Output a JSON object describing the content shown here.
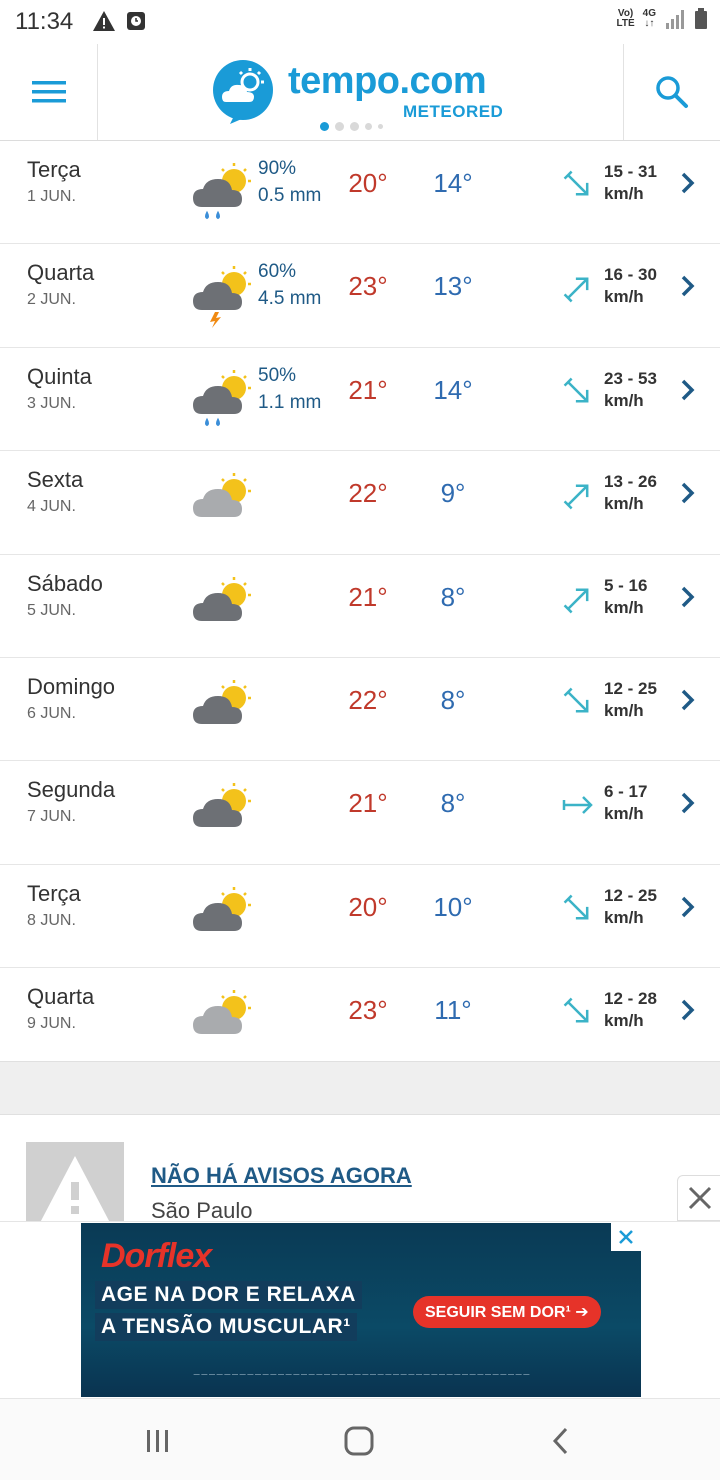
{
  "status_bar": {
    "time": "11:34",
    "volte_top": "Vo)",
    "volte_bottom": "LTE",
    "network_top": "4G",
    "network_bottom": "↓↑"
  },
  "header": {
    "brand": "tempo.com",
    "brand_sub": "METEORED",
    "menu_icon": "hamburger-menu-icon",
    "search_icon": "search-icon",
    "accent_color": "#1a9bd7"
  },
  "forecast": [
    {
      "day": "Terça",
      "date": "1 JUN.",
      "icon": "cloud-rain-sun",
      "precip_prob": "90%",
      "precip_amount": "0.5 mm",
      "tmax": "20°",
      "tmin": "14°",
      "wind_dir": 135,
      "wind_speed": "15 - 31",
      "wind_unit": "km/h"
    },
    {
      "day": "Quarta",
      "date": "2 JUN.",
      "icon": "cloud-storm-sun",
      "precip_prob": "60%",
      "precip_amount": "4.5 mm",
      "tmax": "23°",
      "tmin": "13°",
      "wind_dir": 45,
      "wind_speed": "16 - 30",
      "wind_unit": "km/h"
    },
    {
      "day": "Quinta",
      "date": "3 JUN.",
      "icon": "cloud-rain-sun",
      "precip_prob": "50%",
      "precip_amount": "1.1 mm",
      "tmax": "21°",
      "tmin": "14°",
      "wind_dir": 135,
      "wind_speed": "23 - 53",
      "wind_unit": "km/h"
    },
    {
      "day": "Sexta",
      "date": "4 JUN.",
      "icon": "cloud-sun-light",
      "precip_prob": "",
      "precip_amount": "",
      "tmax": "22°",
      "tmin": "9°",
      "wind_dir": 45,
      "wind_speed": "13 - 26",
      "wind_unit": "km/h"
    },
    {
      "day": "Sábado",
      "date": "5 JUN.",
      "icon": "cloud-sun-dark",
      "precip_prob": "",
      "precip_amount": "",
      "tmax": "21°",
      "tmin": "8°",
      "wind_dir": 45,
      "wind_speed": "5 - 16",
      "wind_unit": "km/h"
    },
    {
      "day": "Domingo",
      "date": "6 JUN.",
      "icon": "cloud-sun-dark",
      "precip_prob": "",
      "precip_amount": "",
      "tmax": "22°",
      "tmin": "8°",
      "wind_dir": 135,
      "wind_speed": "12 - 25",
      "wind_unit": "km/h"
    },
    {
      "day": "Segunda",
      "date": "7 JUN.",
      "icon": "cloud-sun-dark",
      "precip_prob": "",
      "precip_amount": "",
      "tmax": "21°",
      "tmin": "8°",
      "wind_dir": 90,
      "wind_speed": "6 - 17",
      "wind_unit": "km/h"
    },
    {
      "day": "Terça",
      "date": "8 JUN.",
      "icon": "cloud-sun-dark",
      "precip_prob": "",
      "precip_amount": "",
      "tmax": "20°",
      "tmin": "10°",
      "wind_dir": 135,
      "wind_speed": "12 - 25",
      "wind_unit": "km/h"
    },
    {
      "day": "Quarta",
      "date": "9 JUN.",
      "icon": "cloud-sun-light",
      "precip_prob": "",
      "precip_amount": "",
      "tmax": "23°",
      "tmin": "11°",
      "wind_dir": 135,
      "wind_speed": "12 - 28",
      "wind_unit": "km/h"
    }
  ],
  "alert": {
    "title": "NÃO HÁ AVISOS AGORA",
    "location": "São Paulo"
  },
  "ad": {
    "brand": "Dorflex",
    "line1": "AGE NA DOR E RELAXA",
    "line2": "A TENSÃO MUSCULAR¹",
    "cta": "SEGUIR SEM DOR¹ ➔"
  },
  "colors": {
    "tmax": "#c0392b",
    "tmin": "#2f6bb0",
    "wind_arrow": "#3bb3c7"
  }
}
